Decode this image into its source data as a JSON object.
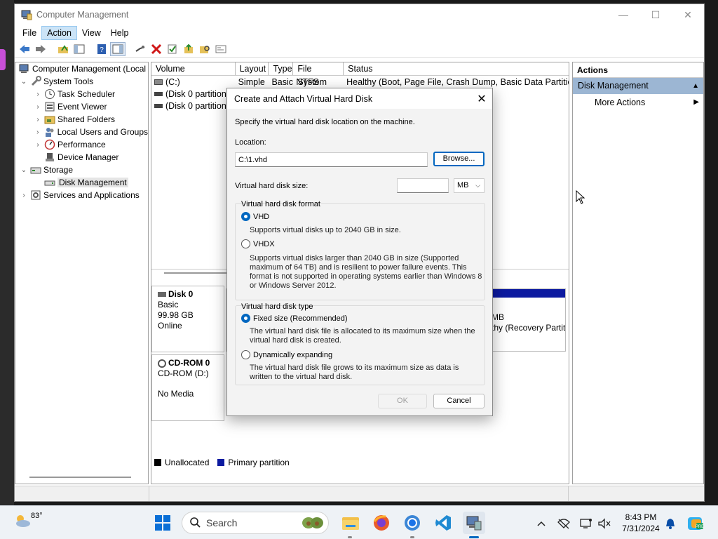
{
  "window": {
    "title": "Computer Management",
    "min": "—",
    "max": "☐",
    "close": "✕"
  },
  "menu": [
    "File",
    "Action",
    "View",
    "Help"
  ],
  "tree": {
    "root": "Computer Management (Local",
    "system_tools": "System Tools",
    "task_scheduler": "Task Scheduler",
    "event_viewer": "Event Viewer",
    "shared_folders": "Shared Folders",
    "local_users": "Local Users and Groups",
    "performance": "Performance",
    "device_manager": "Device Manager",
    "storage": "Storage",
    "disk_management": "Disk Management",
    "services": "Services and Applications"
  },
  "volumes": {
    "headers": [
      "Volume",
      "Layout",
      "Type",
      "File System",
      "Status"
    ],
    "rows": [
      {
        "volume": "(C:)",
        "layout": "Simple",
        "type": "Basic",
        "fs": "NTFS",
        "status": "Healthy (Boot, Page File, Crash Dump, Basic Data Partition)"
      },
      {
        "volume": "(Disk 0 partition",
        "layout": "",
        "type": "",
        "fs": "",
        "status": ""
      },
      {
        "volume": "(Disk 0 partition",
        "layout": "",
        "type": "",
        "fs": "",
        "status": ""
      }
    ]
  },
  "disks": {
    "disk0": {
      "name": "Disk 0",
      "type": "Basic",
      "size": "99.98 GB",
      "state": "Online",
      "part_size": "MB",
      "part_status": "thy (Recovery Partit"
    },
    "cdrom": {
      "name": "CD-ROM 0",
      "drive": "CD-ROM (D:)",
      "media": "No Media"
    }
  },
  "legend": {
    "unallocated": "Unallocated",
    "primary": "Primary partition",
    "unallocated_color": "#000000",
    "primary_color": "#0c1aa0"
  },
  "actions": {
    "header": "Actions",
    "group": "Disk Management",
    "more": "More Actions"
  },
  "dialog": {
    "title": "Create and Attach Virtual Hard Disk",
    "instruction": "Specify the virtual hard disk location on the machine.",
    "location_label": "Location:",
    "location_value": "C:\\1.vhd",
    "browse": "Browse...",
    "size_label": "Virtual hard disk size:",
    "size_value": "",
    "size_unit": "MB",
    "format_group": "Virtual hard disk format",
    "vhd_label": "VHD",
    "vhd_desc": "Supports virtual disks up to 2040 GB in size.",
    "vhdx_label": "VHDX",
    "vhdx_desc": "Supports virtual disks larger than 2040 GB in size (Supported maximum of 64 TB) and is resilient to power failure events. This format is not supported in operating systems earlier than Windows 8 or Windows Server 2012.",
    "type_group": "Virtual hard disk type",
    "fixed_label": "Fixed size (Recommended)",
    "fixed_desc": "The virtual hard disk file is allocated to its maximum size when the virtual hard disk is created.",
    "dynamic_label": "Dynamically expanding",
    "dynamic_desc": "The virtual hard disk file grows to its maximum size as data is written to the virtual hard disk.",
    "ok": "OK",
    "cancel": "Cancel"
  },
  "taskbar": {
    "temp": "83°",
    "search": "Search",
    "time": "8:43 PM",
    "date": "7/31/2024"
  }
}
